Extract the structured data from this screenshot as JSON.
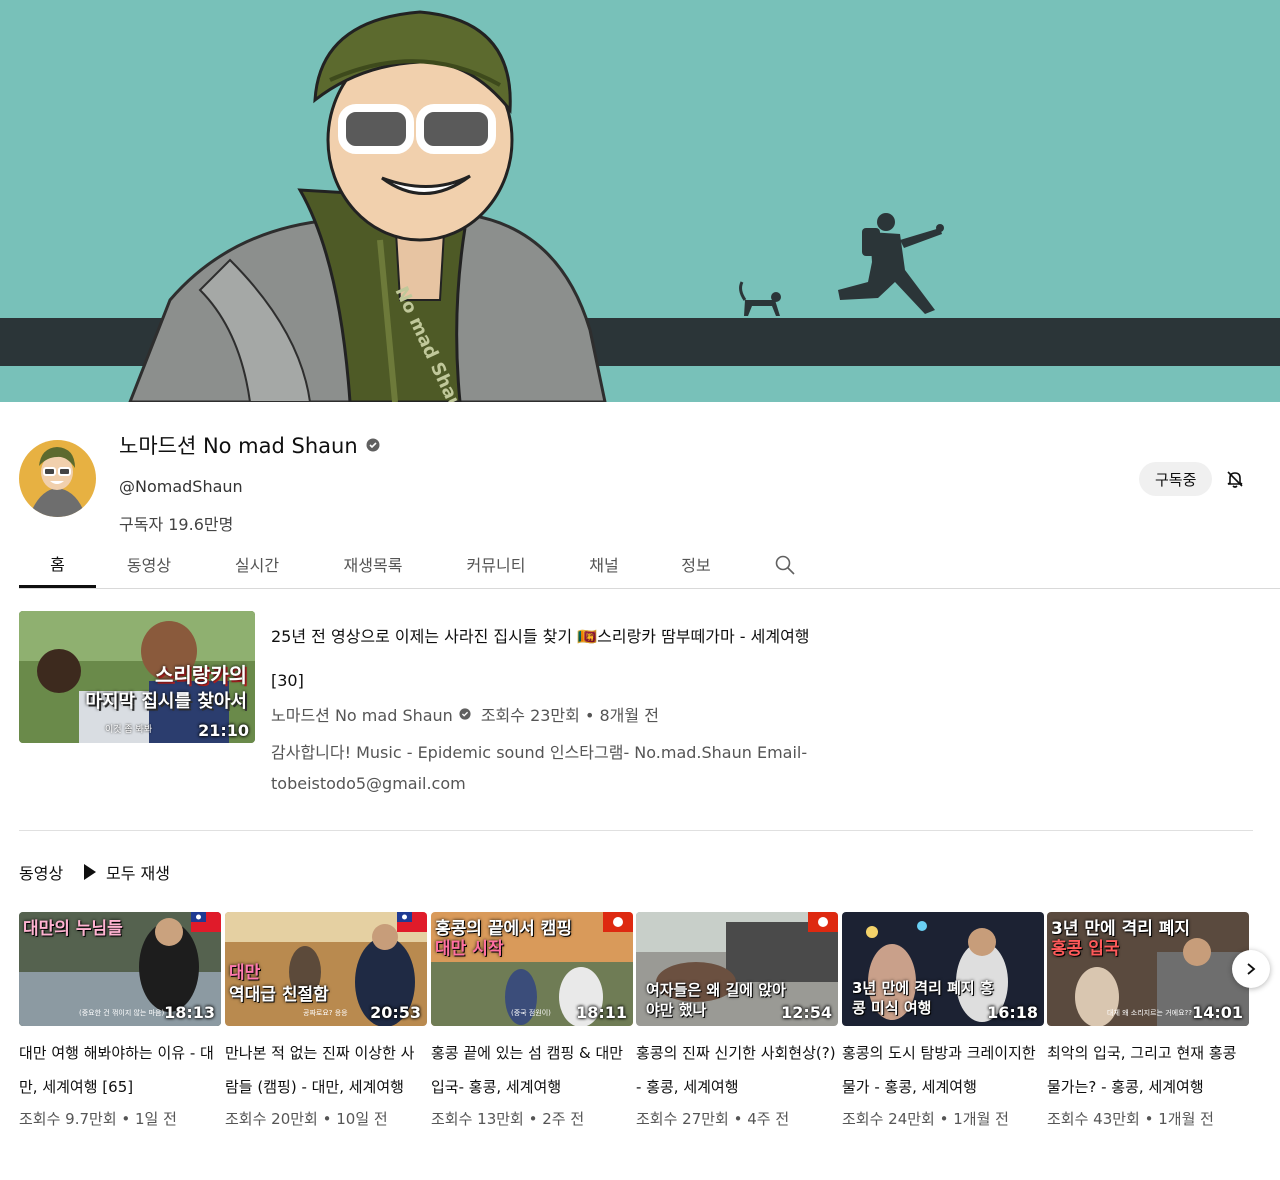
{
  "channel": {
    "name": "노마드션 No mad Shaun",
    "handle": "@NomadShaun",
    "subscribers": "구독자 19.6만명",
    "subscribe_label": "구독중"
  },
  "banner": {
    "scarf_text": "No mad Shaun",
    "bg_color": "#78c1b9",
    "road_color": "#2b3538"
  },
  "tabs": [
    {
      "label": "홈",
      "active": true
    },
    {
      "label": "동영상"
    },
    {
      "label": "실시간"
    },
    {
      "label": "재생목록"
    },
    {
      "label": "커뮤니티"
    },
    {
      "label": "채널"
    },
    {
      "label": "정보"
    }
  ],
  "featured": {
    "title": "25년 전 영상으로 이제는 사라진 집시들 찾기 🇱🇰스리랑카 땀부떼가마 - 세계여행 [30]",
    "channel": "노마드션 No mad Shaun",
    "meta": "조회수 23만회 • 8개월 전",
    "description": "감사합니다! Music - Epidemic sound 인스타그램- No.mad.Shaun Email- tobeistodo5@gmail.com",
    "thumb_line1": "스리랑카의",
    "thumb_line2": "마지막 집시를 찾아서",
    "thumb_small": "이것 좀 봐봐",
    "duration": "21:10"
  },
  "shelf": {
    "title": "동영상",
    "play_all": "모두 재생"
  },
  "videos": [
    {
      "title": "대만 여행 해봐야하는 이유 - 대만, 세계여행 [65]",
      "meta": "조회수 9.7만회 • 1일 전",
      "duration": "18:13",
      "cap1": "대만의 누님들",
      "cap2": "",
      "cap_bottom": "",
      "small": "(중요한 건 꺾이지 않는 마음)",
      "flag": "taiwan"
    },
    {
      "title": "만나본 적 없는 진짜 이상한 사람들 (캠핑) - 대만, 세계여행",
      "meta": "조회수 20만회 • 10일 전",
      "duration": "20:53",
      "cap1": "대만",
      "cap2": "역대급 친절함",
      "cap_bottom": "",
      "small": "공짜로요? 응응",
      "flag": "taiwan"
    },
    {
      "title": "홍콩 끝에 있는 섬 캠핑 & 대만 입국- 홍콩, 세계여행",
      "meta": "조회수 13만회 • 2주 전",
      "duration": "18:11",
      "cap1": "홍콩의 끝에서 캠핑",
      "cap2": "대만 시작",
      "cap_bottom": "",
      "small": "(중국 점원이)",
      "flag": "hongkong"
    },
    {
      "title": "홍콩의 진짜 신기한 사회현상(?) - 홍콩, 세계여행",
      "meta": "조회수 27만회 • 4주 전",
      "duration": "12:54",
      "cap1": "",
      "cap2": "",
      "cap_bottom": "여자들은 왜 길에 앉아야만 했나",
      "small": "",
      "flag": "hongkong"
    },
    {
      "title": "홍콩의 도시 탐방과 크레이지한 물가 - 홍콩, 세계여행",
      "meta": "조회수 24만회 • 1개월 전",
      "duration": "16:18",
      "cap1": "",
      "cap2": "",
      "cap_bottom": "3년 만에 격리 폐지 홍콩 미식 여행",
      "small": "",
      "flag": ""
    },
    {
      "title": "최악의 입국, 그리고 현재 홍콩 물가는? - 홍콩, 세계여행",
      "meta": "조회수 43만회 • 1개월 전",
      "duration": "14:01",
      "cap1": "3년 만에 격리 폐지",
      "cap2": "홍콩 입국",
      "cap_bottom": "",
      "small": "대체 왜 소리지르는 거에요??",
      "flag": ""
    }
  ]
}
